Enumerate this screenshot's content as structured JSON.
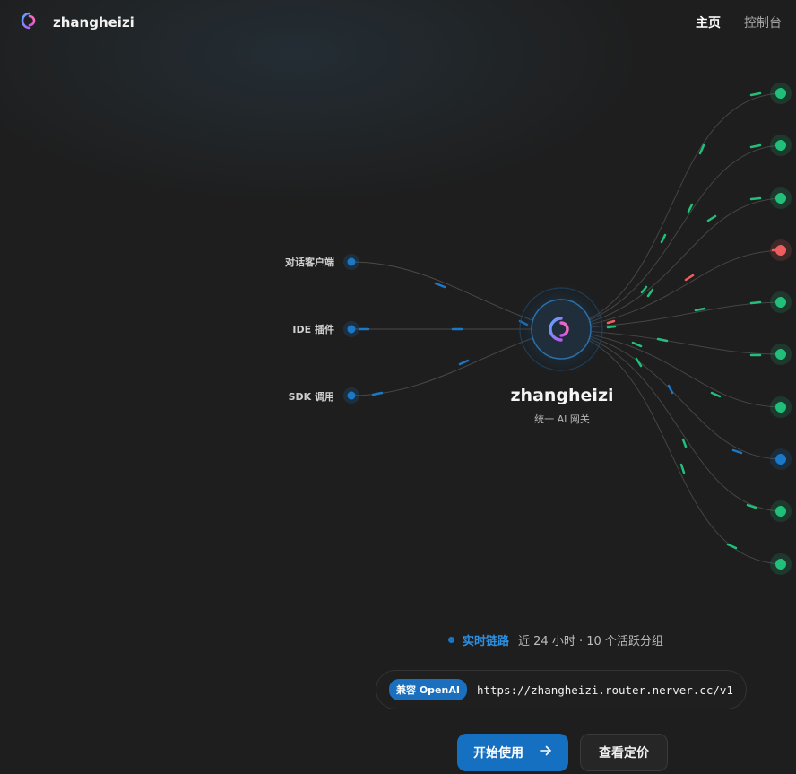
{
  "brand": {
    "name": "zhangheizi",
    "logo_icon": "swirl-logo-icon"
  },
  "nav": {
    "home": "主页",
    "console": "控制台"
  },
  "clients": [
    {
      "label": "对话客户端"
    },
    {
      "label": "IDE 插件"
    },
    {
      "label": "SDK 调用"
    }
  ],
  "hub": {
    "title": "zhangheizi",
    "subtitle": "统一 AI 网关"
  },
  "upstreams": [
    {
      "status": "healthy"
    },
    {
      "status": "healthy"
    },
    {
      "status": "healthy"
    },
    {
      "status": "error"
    },
    {
      "status": "healthy"
    },
    {
      "status": "healthy"
    },
    {
      "status": "healthy"
    },
    {
      "status": "info"
    },
    {
      "status": "healthy"
    },
    {
      "status": "healthy"
    }
  ],
  "colors": {
    "healthy": "#20c07a",
    "error": "#ef5e5e",
    "info": "#1b78c7",
    "accent": "#1670c2"
  },
  "status_bar": {
    "live_label": "实时链路",
    "summary": "近 24 小时 · 10 个活跃分组"
  },
  "endpoint": {
    "badge": "兼容 OpenAI",
    "url": "https://zhangheizi.router.nerver.cc/v1"
  },
  "actions": {
    "start_label": "开始使用",
    "start_icon": "arrow-right-icon",
    "pricing_label": "查看定价"
  }
}
